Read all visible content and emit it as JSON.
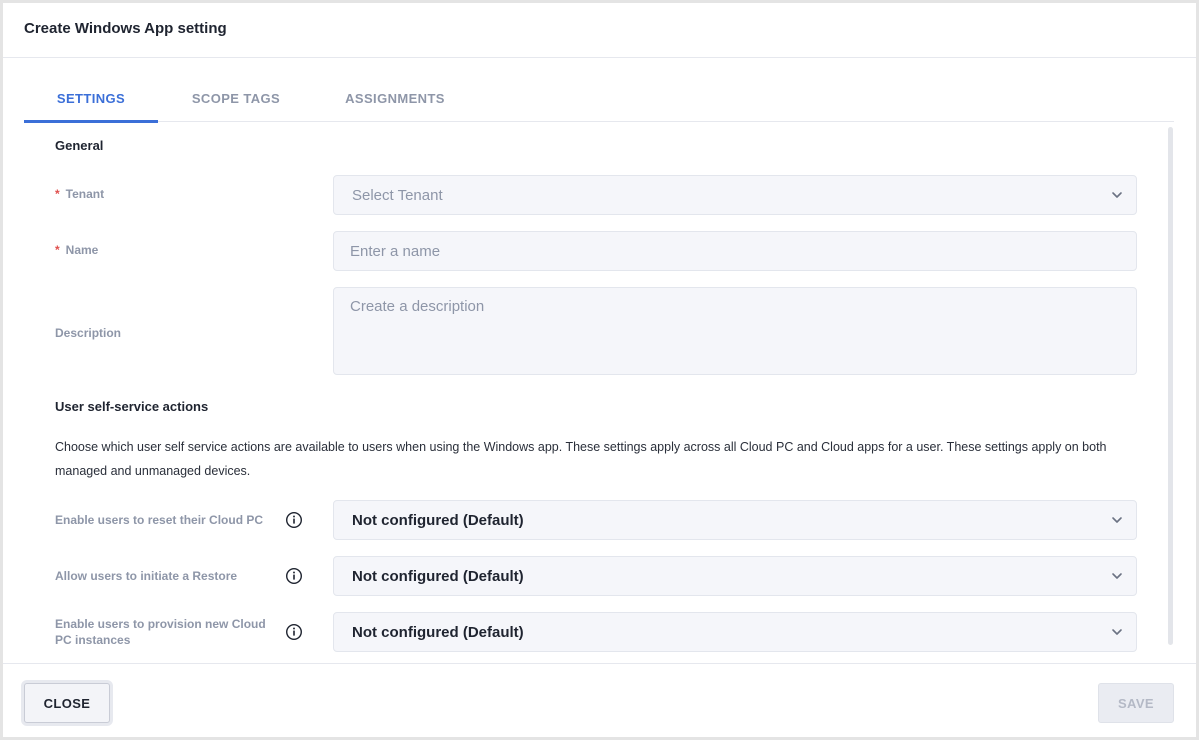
{
  "dialog": {
    "title": "Create Windows App setting"
  },
  "tabs": [
    {
      "label": "SETTINGS",
      "active": true
    },
    {
      "label": "SCOPE TAGS",
      "active": false
    },
    {
      "label": "ASSIGNMENTS",
      "active": false
    }
  ],
  "general": {
    "title": "General",
    "tenant": {
      "label": "Tenant",
      "required": "*",
      "placeholder": "Select Tenant",
      "icon": "chevron-down-icon"
    },
    "name": {
      "label": "Name",
      "required": "*",
      "placeholder": "Enter a name"
    },
    "description": {
      "label": "Description",
      "placeholder": "Create a description"
    }
  },
  "self_service": {
    "title": "User self-service actions",
    "description": "Choose which user self service actions are available to users when using the Windows app. These settings apply across all Cloud PC and Cloud apps for a user. These settings apply on both managed and unmanaged devices.",
    "settings": [
      {
        "label": "Enable users to reset their Cloud PC",
        "value": "Not configured (Default)",
        "icon": "info-icon"
      },
      {
        "label": "Allow users to initiate a Restore",
        "value": "Not configured (Default)",
        "icon": "info-icon"
      },
      {
        "label": "Enable users to provision new Cloud PC instances",
        "value": "Not configured (Default)",
        "icon": "info-icon"
      }
    ]
  },
  "footer": {
    "close_label": "CLOSE",
    "save_label": "SAVE",
    "save_enabled": false
  },
  "colors": {
    "accent": "#3b6fd8",
    "required": "#e0504e",
    "muted_text": "#8e96a8",
    "field_bg": "#f5f6fa"
  }
}
